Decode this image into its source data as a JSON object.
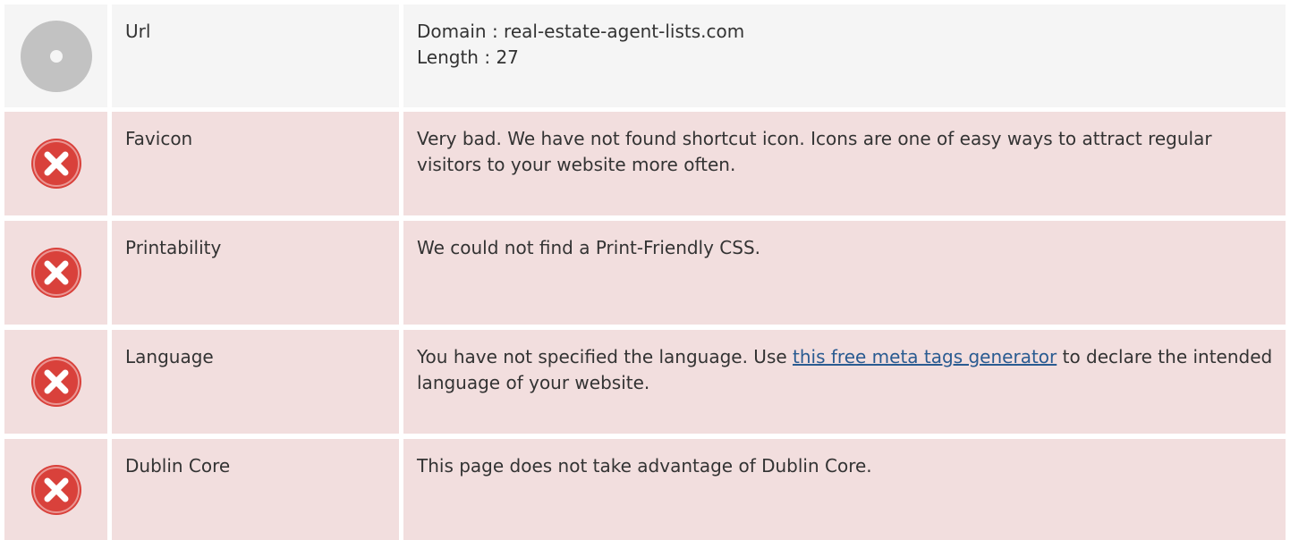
{
  "colors": {
    "info_row_bg": "#f5f5f5",
    "bad_row_bg": "#f2dede",
    "error_icon": "#d9413b",
    "neutral_icon": "#c2c2c2",
    "link": "#2a5b91"
  },
  "rows": {
    "url": {
      "label": "Url",
      "status_icon": "neutral-circle-icon",
      "domain_line": "Domain : real-estate-agent-lists.com",
      "length_line": "Length : 27"
    },
    "favicon": {
      "label": "Favicon",
      "status_icon": "error-x-icon",
      "description": "Very bad. We have not found shortcut icon. Icons are one of easy ways to attract regular visitors to your website more often."
    },
    "printability": {
      "label": "Printability",
      "status_icon": "error-x-icon",
      "description": "We could not find a Print-Friendly CSS."
    },
    "language": {
      "label": "Language",
      "status_icon": "error-x-icon",
      "description_before": "You have not specified the language. Use ",
      "link_text": "this free meta tags generator",
      "description_after": " to declare the intended language of your website."
    },
    "dublin_core": {
      "label": "Dublin Core",
      "status_icon": "error-x-icon",
      "description": "This page does not take advantage of Dublin Core."
    }
  }
}
